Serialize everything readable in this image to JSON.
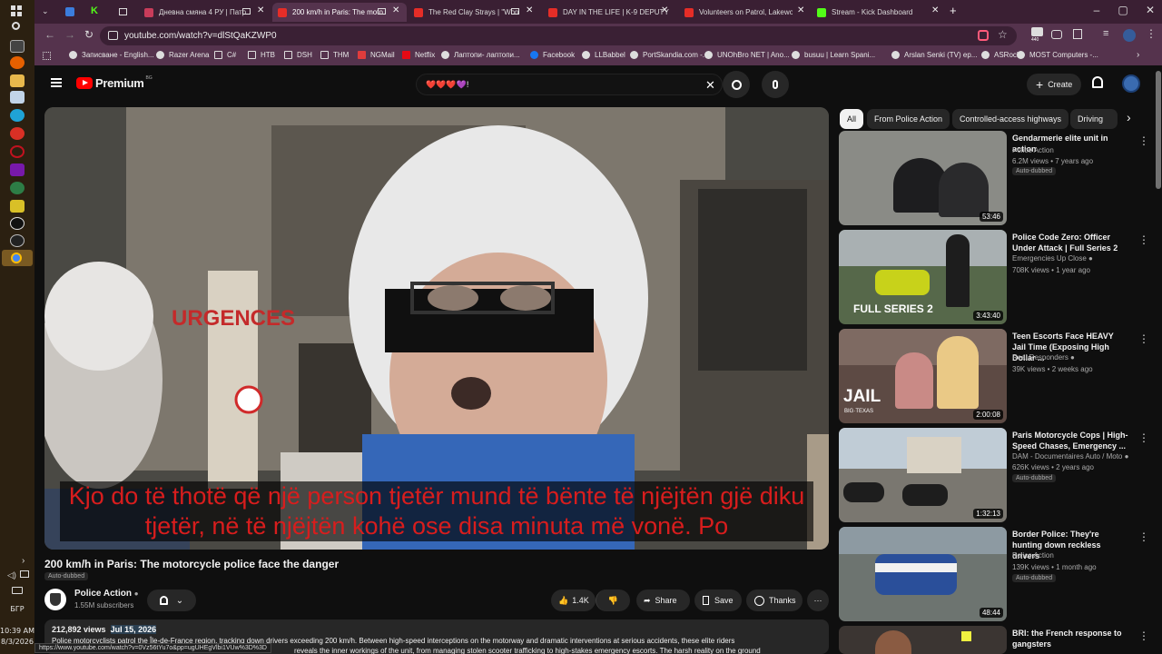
{
  "taskbar": {
    "language": "БГР",
    "time": "10:39 AM",
    "date": "8/3/2026"
  },
  "tabs": [
    {
      "label": "Дневна смяна 4 РУ | Патр",
      "color": "#c83c5a"
    },
    {
      "label": "200 km/h in Paris: The moto",
      "color": "#e52d27"
    },
    {
      "label": "The Red Clay Strays | \"Won",
      "color": "#e52d27"
    },
    {
      "label": "DAY IN THE LIFE | K-9 DEPUTY",
      "color": "#e52d27"
    },
    {
      "label": "Volunteers on Patrol, Lakewood",
      "color": "#e52d27"
    },
    {
      "label": "Stream - Kick Dashboard",
      "color": "#53fc18"
    }
  ],
  "address": {
    "url": "youtube.com/watch?v=dlStQaKZWP0"
  },
  "bookmarks": [
    "Записване - English...",
    "Razer Arena",
    "C#",
    "НТВ",
    "DSH",
    "THM",
    "NGMail",
    "Netflix",
    "Лаптопи- лаптопи...",
    "Facebook",
    "LLBabbel",
    "PortSkandia.com -...",
    "UNOhBro NET | Ano...",
    "busuu | Learn Spani...",
    "Arslan Senki (TV) ep...",
    "ASRock",
    "MOST Computers -..."
  ],
  "header": {
    "logo": "Premium",
    "logo_sup": "BG",
    "search_value": "❤️❤️❤️💜!",
    "create_label": "Create"
  },
  "player": {
    "subtitle_line1": "Kjo do të thotë që një person tjetër mund të bënte të njëjtën gjë diku",
    "subtitle_line2": "tjetër, në të njëjtën kohë ose disa minuta më vonë.  Po",
    "sign_text": "URGENCES"
  },
  "video": {
    "title": "200 km/h in Paris: The motorcycle police face the danger",
    "auto_dubbed": "Auto-dubbed",
    "channel": "Police Action",
    "subscribers": "1.55M subscribers",
    "likes": "1.4K",
    "share": "Share",
    "save": "Save",
    "thanks": "Thanks",
    "views": "212,892 views",
    "date": "Jul 15, 2026",
    "description": "Police motorcyclists patrol the Île-de-France region, tracking down drivers exceeding 200 km/h. Between high-speed interceptions on the motorway and dramatic interventions at serious accidents, these elite riders",
    "description2": "reveals the inner workings of the unit, from managing stolen scooter trafficking to high-stakes emergency escorts. The harsh reality on the ground",
    "status_url": "https://www.youtube.com/watch?v=0Vz56tYu7o&pp=ugUHEgVlbi1VUw%3D%3D"
  },
  "chips": [
    "All",
    "From Police Action",
    "Controlled-access highways",
    "Driving"
  ],
  "recommendations": [
    {
      "title": "Gendarmerie elite unit in action",
      "channel": "Police Action",
      "verified": false,
      "meta": "6.2M views • 7 years ago",
      "badge": "Auto-dubbed",
      "duration": "53:46",
      "bg": "#8a8b86"
    },
    {
      "title": "Police Code Zero: Officer Under Attack | Full Series 2",
      "channel": "Emergencies Up Close",
      "verified": true,
      "meta": "708K views • 1 year ago",
      "badge": "",
      "duration": "3:43:40",
      "bg": "#56684a",
      "overlay": "FULL SERIES 2"
    },
    {
      "title": "Teen Escorts Face HEAVY Jail Time (Exposing High Dollar ...",
      "channel": "Real Responders",
      "verified": true,
      "meta": "39K views • 2 weeks ago",
      "badge": "",
      "duration": "2:00:08",
      "bg": "#5d4a44",
      "overlay": "JAIL",
      "overlay2": "BIG·TEXAS"
    },
    {
      "title": "Paris Motorcycle Cops | High-Speed Chases, Emergency ...",
      "channel": "DAM - Documentaires Auto / Moto",
      "verified": true,
      "meta": "626K views • 2 years ago",
      "badge": "Auto-dubbed",
      "duration": "1:32:13",
      "bg": "#7a7770"
    },
    {
      "title": "Border Police: They're hunting down reckless drivers",
      "channel": "Police Action",
      "verified": false,
      "meta": "139K views • 1 month ago",
      "badge": "Auto-dubbed",
      "duration": "48:44",
      "bg": "#6d7470"
    },
    {
      "title": "BRI: the French response to gangsters",
      "channel": "",
      "verified": false,
      "meta": "",
      "badge": "",
      "duration": "",
      "bg": "#3b3532"
    }
  ],
  "colors": {
    "yt_red": "#ff0000",
    "subtitle": "#d81d1d",
    "chrome_tab": "#3a1f33",
    "chrome_bar": "#55334d"
  }
}
